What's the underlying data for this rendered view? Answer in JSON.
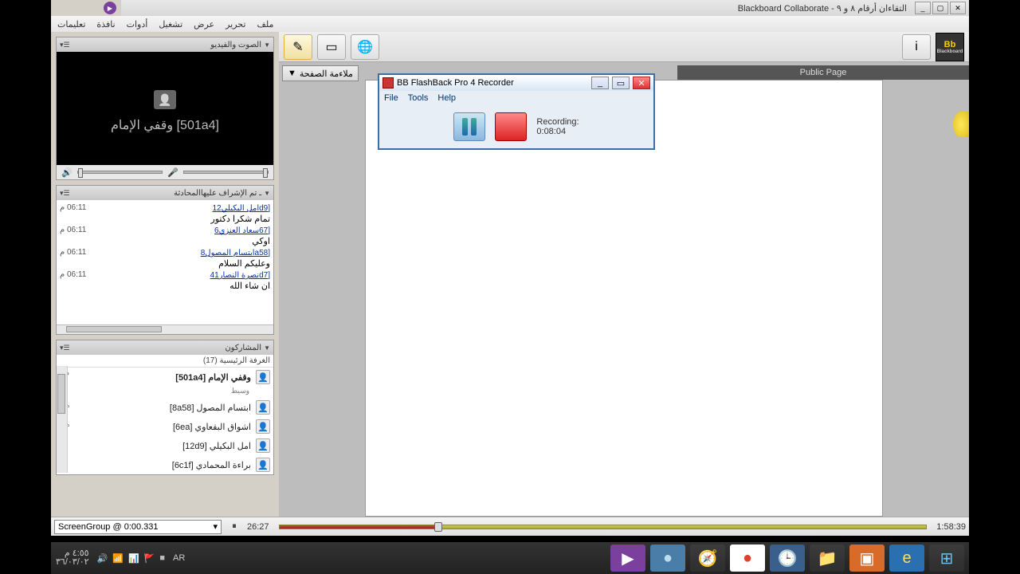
{
  "window": {
    "title": "Blackboard Collaborate - التقاءان أرقام ٨ و ٩",
    "min": "_",
    "max": "▢",
    "close": "✕"
  },
  "menu": {
    "file": "ملف",
    "edit": "تحرير",
    "view": "عرض",
    "run": "تشغيل",
    "tools": "أدوات",
    "window": "نافذة",
    "help": "تعليمات"
  },
  "av": {
    "title": "الصوت والفيديو",
    "speaker_name": "وقفي الإمام [501a4]",
    "mic_icon": "🎤",
    "spk_icon": "🔊"
  },
  "chat": {
    "title": "ـ تم الإشراف عليهاالمحادثة",
    "messages": [
      {
        "user": "[d9امل البكيلي12",
        "time": "06:11 م",
        "text": "تمام شكرا دكتور"
      },
      {
        "user": "[67سعاد العنزي6",
        "time": "06:11 م",
        "text": "اوكي"
      },
      {
        "user": "[a58ابتسام المصول8",
        "time": "06:11 م",
        "text": "وعليكم السلام"
      },
      {
        "user": "[d7نصرة النصار41",
        "time": "06:11 م",
        "text": "ان شاء الله"
      }
    ]
  },
  "participants": {
    "title": "المشاركون",
    "room": "الغرفة الرئيسية  (17)",
    "list": [
      {
        "name": "وقفي الإمام [501a4]",
        "sub": "وسيط",
        "mic": true,
        "bold": true
      },
      {
        "name": "ابتسام المصول [8a58]",
        "pg": true
      },
      {
        "name": "اشواق البقعاوي [6ea]",
        "pg": true
      },
      {
        "name": "امل البكيلي [12d9]"
      },
      {
        "name": "براءة المحمادي [6c1f]"
      }
    ]
  },
  "fit": {
    "label": "ملاءمة الصفحة",
    "arrow": "▼"
  },
  "pubpage": "Public Page",
  "bb": "Bb",
  "recorder": {
    "title": "BB FlashBack Pro 4 Recorder",
    "menu": {
      "file": "File",
      "tools": "Tools",
      "help": "Help"
    },
    "label": "Recording:",
    "time": "0:08:04",
    "min": "_",
    "max": "▭",
    "close": "✕"
  },
  "player": {
    "clip": "ScreenGroup @ 0:00.331",
    "arrow": "▾",
    "pause": "⏸",
    "cur": "26:27",
    "dur": "1:58:39"
  },
  "taskbar": {
    "clock_time": "٤:٥٥ م",
    "clock_date": "٣٦/٠٣/٠٢",
    "lang": "AR",
    "apps": [
      {
        "name": "collaborate-icon",
        "glyph": "▶",
        "bg": "#7b3f9e",
        "fg": "#fff"
      },
      {
        "name": "browser1-icon",
        "glyph": "●",
        "bg": "#4a7da8",
        "fg": "#bde"
      },
      {
        "name": "safari-icon",
        "glyph": "🧭",
        "bg": "",
        "fg": ""
      },
      {
        "name": "chrome-icon",
        "glyph": "●",
        "bg": "#fff",
        "fg": "#e04030"
      },
      {
        "name": "clock-app-icon",
        "glyph": "🕒",
        "bg": "#3a5f8a",
        "fg": "#fff"
      },
      {
        "name": "explorer-icon",
        "glyph": "📁",
        "bg": "",
        "fg": ""
      },
      {
        "name": "ppt-icon",
        "glyph": "▣",
        "bg": "#d86a2a",
        "fg": "#fff"
      },
      {
        "name": "ie-icon",
        "glyph": "e",
        "bg": "#2a6fb0",
        "fg": "#fde05a"
      },
      {
        "name": "start-icon",
        "glyph": "⊞",
        "bg": "",
        "fg": "#6ac0f0"
      }
    ],
    "sys": [
      "🔊",
      "📶",
      "📊",
      "🚩",
      "■"
    ]
  }
}
